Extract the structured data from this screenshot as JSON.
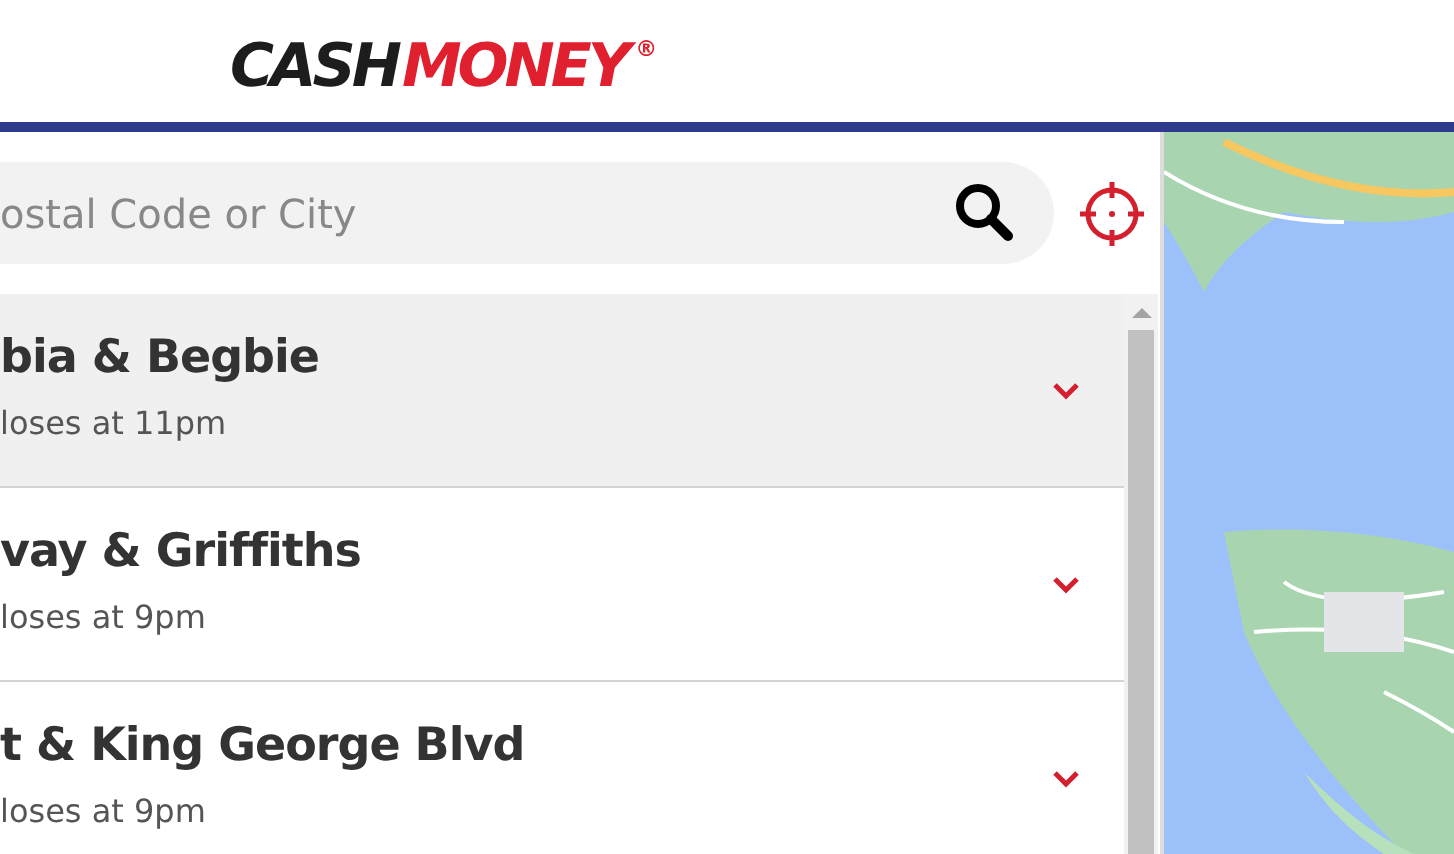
{
  "header": {
    "logo": {
      "first": "CASH",
      "second": "MONEY",
      "mark": "®"
    }
  },
  "search": {
    "placeholder": "ostal Code or City"
  },
  "locations": [
    {
      "name": "bia & Begbie",
      "hours": "loses at 11pm",
      "selected": true
    },
    {
      "name": "vay & Griffiths",
      "hours": "loses at 9pm",
      "selected": false
    },
    {
      "name": "t & King George Blvd",
      "hours": "loses at 9pm",
      "selected": false
    }
  ]
}
